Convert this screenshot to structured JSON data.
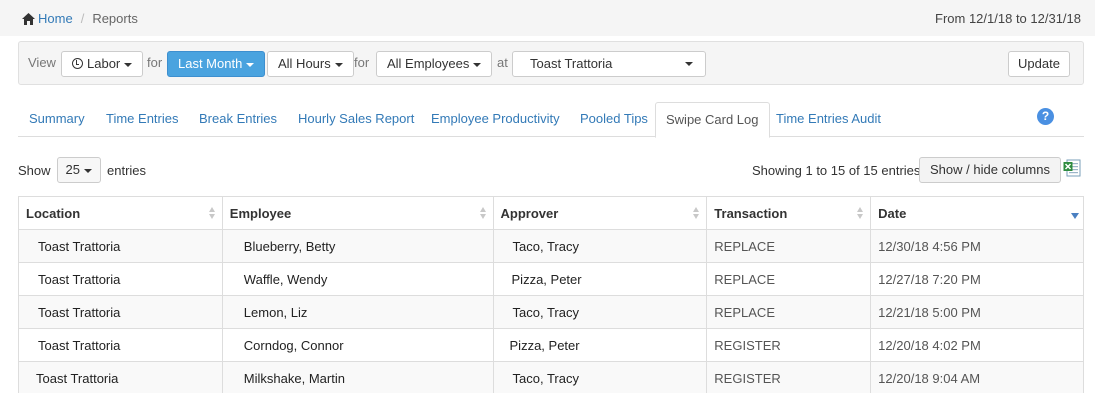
{
  "breadcrumb": {
    "home_label": "Home",
    "current": "Reports"
  },
  "date_range": "From 12/1/18 to 12/31/18",
  "filters": {
    "view_label": "View",
    "view_value": "Labor",
    "for_label_1": "for",
    "period_value": "Last Month",
    "hours_value": "All Hours",
    "for_label_2": "for",
    "employees_value": "All Employees",
    "at_label": "at",
    "location_value": "Toast Trattoria",
    "update_label": "Update"
  },
  "tabs": [
    {
      "label": "Summary"
    },
    {
      "label": "Time Entries"
    },
    {
      "label": "Break Entries"
    },
    {
      "label": "Hourly Sales Report"
    },
    {
      "label": "Employee Productivity"
    },
    {
      "label": "Pooled Tips"
    },
    {
      "label": "Swipe Card Log"
    },
    {
      "label": "Time Entries Audit"
    }
  ],
  "active_tab": "Swipe Card Log",
  "help_glyph": "?",
  "table_controls": {
    "show_label": "Show",
    "page_length": "25",
    "entries_label": "entries",
    "info": "Showing 1 to 15 of 15 entries",
    "columns_button": "Show / hide columns"
  },
  "table": {
    "headers": [
      "Location",
      "Employee",
      "Approver",
      "Transaction",
      "Date"
    ],
    "rows": [
      [
        "Toast Trattoria",
        "Blueberry, Betty",
        "Taco, Tracy",
        "REPLACE",
        "12/30/18 4:56 PM"
      ],
      [
        "Toast Trattoria",
        "Waffle, Wendy",
        "Pizza, Peter",
        "REPLACE",
        "12/27/18 7:20 PM"
      ],
      [
        "Toast Trattoria",
        "Lemon, Liz",
        "Taco, Tracy",
        "REPLACE",
        "12/21/18 5:00 PM"
      ],
      [
        "Toast Trattoria",
        "Corndog, Connor",
        "Pizza, Peter",
        "REGISTER",
        "12/20/18 4:02 PM"
      ],
      [
        "Toast Trattoria",
        "Milkshake, Martin",
        "Taco, Tracy",
        "REGISTER",
        "12/20/18 9:04 AM"
      ]
    ]
  },
  "colors": {
    "link": "#337ab7",
    "primary_button": "#4aa3df",
    "help": "#4a90e2",
    "sort_active": "#4a7fc1"
  }
}
